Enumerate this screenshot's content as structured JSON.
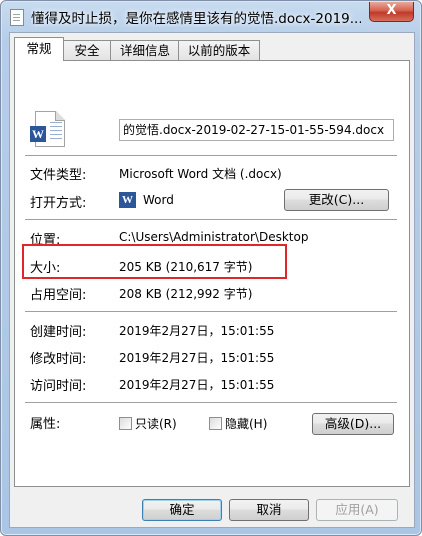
{
  "window": {
    "title": "懂得及时止损，是你在感情里该有的觉悟.docx-2019...",
    "close_glyph": "X"
  },
  "tabs": [
    {
      "label": "常规",
      "active": true
    },
    {
      "label": "安全",
      "active": false
    },
    {
      "label": "详细信息",
      "active": false
    },
    {
      "label": "以前的版本",
      "active": false
    }
  ],
  "general": {
    "filename": "的觉悟.docx-2019-02-27-15-01-55-594.docx",
    "file_type_label": "文件类型:",
    "file_type_value": "Microsoft Word 文档 (.docx)",
    "opens_with_label": "打开方式:",
    "opens_with_value": "Word",
    "change_button": "更改(C)...",
    "location_label": "位置:",
    "location_value": "C:\\Users\\Administrator\\Desktop",
    "size_label": "大小:",
    "size_value": "205 KB (210,617 字节)",
    "size_on_disk_label": "占用空间:",
    "size_on_disk_value": "208 KB (212,992 字节)",
    "created_label": "创建时间:",
    "created_value": "2019年2月27日，15:01:55",
    "modified_label": "修改时间:",
    "modified_value": "2019年2月27日，15:01:55",
    "accessed_label": "访问时间:",
    "accessed_value": "2019年2月27日，15:01:55",
    "attributes_label": "属性:",
    "readonly_label": "只读(R)",
    "hidden_label": "隐藏(H)",
    "advanced_button": "高级(D)..."
  },
  "footer": {
    "ok": "确定",
    "cancel": "取消",
    "apply": "应用(A)"
  },
  "icons": {
    "word_badge": "W"
  },
  "colors": {
    "highlight": "#e0262a",
    "word_blue": "#2b579a"
  }
}
